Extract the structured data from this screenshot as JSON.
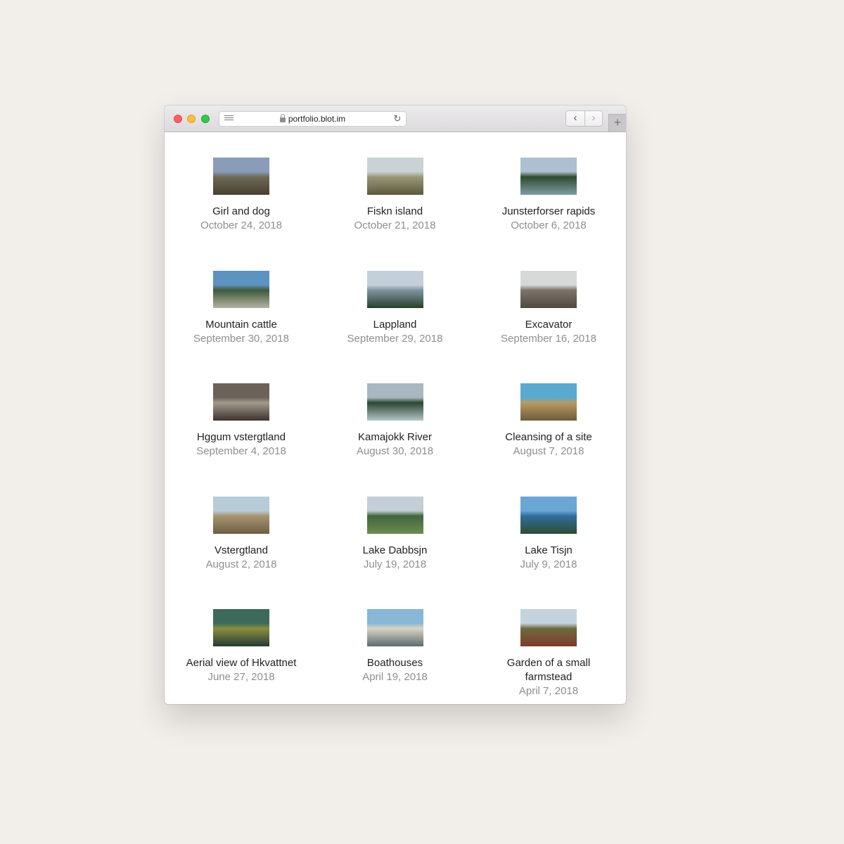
{
  "browser": {
    "url": "portfolio.blot.im",
    "back_glyph": "‹",
    "forward_glyph": "›",
    "new_tab_glyph": "+",
    "reload_glyph": "↻"
  },
  "posts": [
    {
      "title": "Girl and dog",
      "date": "October 24, 2018",
      "colors": [
        "#8a9cb8",
        "#6d6a55",
        "#4a3f30"
      ]
    },
    {
      "title": "Fiskn island",
      "date": "October 21, 2018",
      "colors": [
        "#c9d3d6",
        "#9a9678",
        "#5c5a3e"
      ]
    },
    {
      "title": "Junsterforser rapids",
      "date": "October 6, 2018",
      "colors": [
        "#aebfcf",
        "#2f4a2e",
        "#7f9ea6"
      ]
    },
    {
      "title": "Mountain cattle",
      "date": "September 30, 2018",
      "colors": [
        "#5d93c0",
        "#3f5a3a",
        "#b7b2a2"
      ]
    },
    {
      "title": "Lappland",
      "date": "September 29, 2018",
      "colors": [
        "#c4d0d9",
        "#7f93a0",
        "#26402a"
      ]
    },
    {
      "title": "Excavator",
      "date": "September 16, 2018",
      "colors": [
        "#d7d9d8",
        "#7d7468",
        "#4f4a42"
      ]
    },
    {
      "title": "Hggum vstergtland",
      "date": "September 4, 2018",
      "colors": [
        "#6b625a",
        "#a39a8c",
        "#3c342e"
      ]
    },
    {
      "title": "Kamajokk River",
      "date": "August 30, 2018",
      "colors": [
        "#a9b7c2",
        "#2b4632",
        "#b4c4c6"
      ]
    },
    {
      "title": "Cleansing of a site",
      "date": "August 7, 2018",
      "colors": [
        "#5aa9cf",
        "#b79a64",
        "#6d5c3c"
      ]
    },
    {
      "title": "Vstergtland",
      "date": "August 2, 2018",
      "colors": [
        "#b8ccd8",
        "#a79470",
        "#6d5e45"
      ]
    },
    {
      "title": "Lake Dabbsjn",
      "date": "July 19, 2018",
      "colors": [
        "#c3ced6",
        "#41663d",
        "#6c8b52"
      ]
    },
    {
      "title": "Lake Tisjn",
      "date": "July 9, 2018",
      "colors": [
        "#6ba7d4",
        "#2f6e9e",
        "#2e4c32"
      ]
    },
    {
      "title": "Aerial view of Hkvattnet",
      "date": "June 27, 2018",
      "colors": [
        "#3d6a5a",
        "#8c8d3f",
        "#243b34"
      ]
    },
    {
      "title": "Boathouses",
      "date": "April 19, 2018",
      "colors": [
        "#88b7d8",
        "#d9d4c5",
        "#5a6b6e"
      ]
    },
    {
      "title": "Garden of a small farmstead",
      "date": "April 7, 2018",
      "colors": [
        "#c4d4df",
        "#6d6a3e",
        "#7e3a2c"
      ]
    }
  ]
}
